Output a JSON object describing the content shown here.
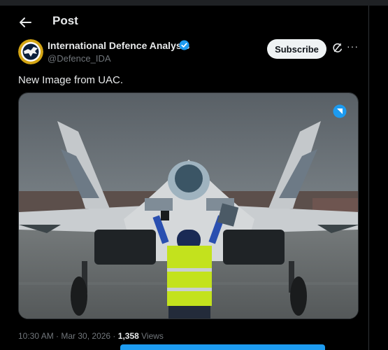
{
  "header": {
    "title": "Post"
  },
  "author": {
    "name": "International Defence Analysis",
    "handle": "@Defence_IDA",
    "verified": true
  },
  "actions": {
    "subscribe_label": "Subscribe",
    "more_label": "···"
  },
  "tweet": {
    "text": "New Image from UAC."
  },
  "meta": {
    "time": "10:30 AM",
    "sep1": " · ",
    "date": "Mar 30, 2026",
    "sep2": " · ",
    "views_count": "1,358",
    "views_label": " Views"
  },
  "colors": {
    "accent": "#1d9bf0",
    "background": "#000000",
    "muted": "#71767b"
  }
}
